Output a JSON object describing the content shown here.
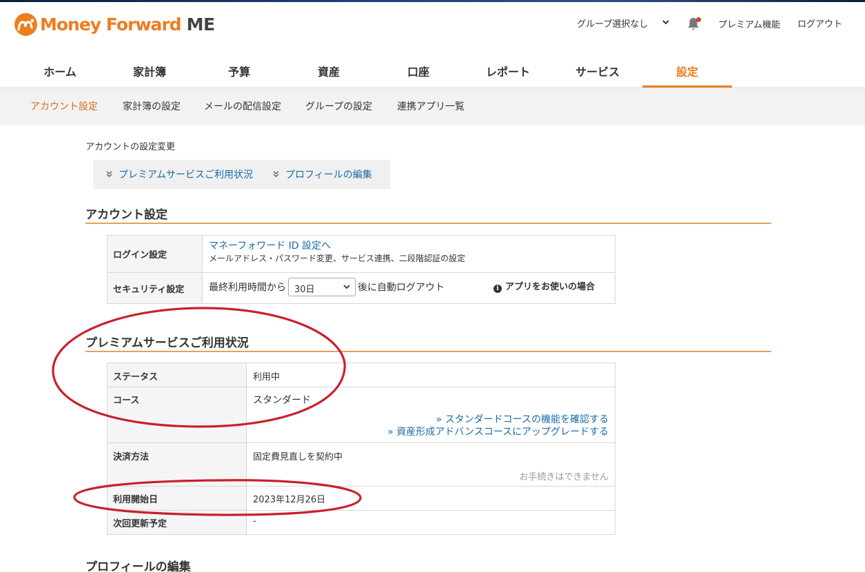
{
  "header": {
    "logo_text": "Money Forward",
    "logo_suffix": "ME",
    "group_select": "グループ選択なし",
    "premium_link": "プレミアム機能",
    "logout_link": "ログアウト"
  },
  "main_nav": [
    {
      "label": "ホーム"
    },
    {
      "label": "家計簿"
    },
    {
      "label": "予算"
    },
    {
      "label": "資産"
    },
    {
      "label": "口座"
    },
    {
      "label": "レポート"
    },
    {
      "label": "サービス"
    },
    {
      "label": "設定",
      "active": true
    }
  ],
  "sub_nav": [
    {
      "label": "アカウント設定",
      "active": true
    },
    {
      "label": "家計簿の設定"
    },
    {
      "label": "メールの配信設定"
    },
    {
      "label": "グループの設定"
    },
    {
      "label": "連携アプリ一覧"
    }
  ],
  "page": {
    "title": "アカウントの設定変更",
    "anchors": [
      "プレミアムサービスご利用状況",
      "プロフィールの編集"
    ]
  },
  "account_settings": {
    "heading": "アカウント設定",
    "login": {
      "label": "ログイン設定",
      "link": "マネーフォワード ID 設定へ",
      "description": "メールアドレス・パスワード変更、サービス連携、二段階認証の設定"
    },
    "security": {
      "label": "セキュリティ設定",
      "prefix": "最終利用時間から",
      "selected": "30日",
      "suffix": "後に自動ログアウト",
      "app_note": "アプリをお使いの場合"
    }
  },
  "premium": {
    "heading": "プレミアムサービスご利用状況",
    "status_label": "ステータス",
    "status_value": "利用中",
    "course_label": "コース",
    "course_value": "スタンダード",
    "course_link_1": "» スタンダードコースの機能を確認する",
    "course_link_2": "» 資産形成アドバンスコースにアップグレードする",
    "payment_label": "決済方法",
    "payment_value": "固定費見直しを契約中",
    "payment_note": "お手続きはできません",
    "start_label": "利用開始日",
    "start_value": "2023年12月26日",
    "renew_label": "次回更新予定",
    "renew_value": "-"
  },
  "profile": {
    "heading": "プロフィールの編集"
  },
  "colors": {
    "brand_orange": "#ee7d1f",
    "link_blue": "#1a6ba8",
    "annotation_red": "#c8202a"
  }
}
